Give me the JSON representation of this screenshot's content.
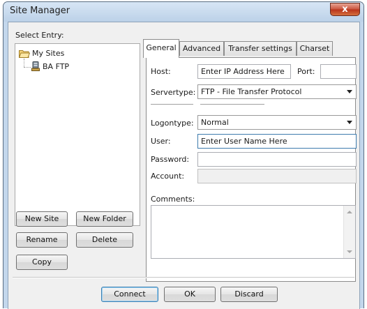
{
  "window": {
    "title": "Site Manager",
    "close_label": "x"
  },
  "tree": {
    "label": "Select Entry:",
    "root": {
      "label": "My Sites",
      "icon": "folder-open-icon"
    },
    "site": {
      "label": "BA FTP",
      "icon": "server-icon"
    }
  },
  "buttons": {
    "new_site": "New Site",
    "new_folder": "New Folder",
    "rename": "Rename",
    "delete": "Delete",
    "copy": "Copy",
    "connect": "Connect",
    "ok": "OK",
    "discard": "Discard"
  },
  "tabs": [
    {
      "label": "General",
      "active": true
    },
    {
      "label": "Advanced",
      "active": false
    },
    {
      "label": "Transfer settings",
      "active": false
    },
    {
      "label": "Charset",
      "active": false
    }
  ],
  "general": {
    "host": {
      "label": "Host:",
      "value": "Enter IP Address Here"
    },
    "port": {
      "label": "Port:",
      "value": ""
    },
    "servertype": {
      "label": "Servertype:",
      "value": "FTP - File Transfer Protocol"
    },
    "logontype": {
      "label": "Logontype:",
      "value": "Normal"
    },
    "user": {
      "label": "User:",
      "value": "Enter User Name Here"
    },
    "password": {
      "label": "Password:",
      "value": ""
    },
    "account": {
      "label": "Account:",
      "value": ""
    },
    "comments": {
      "label": "Comments:",
      "value": ""
    }
  },
  "colors": {
    "frame": "#c3d7ec",
    "close_button": "#c9533c",
    "dialog_bg": "#f0f0f0",
    "focus_border": "#3d7bad"
  }
}
